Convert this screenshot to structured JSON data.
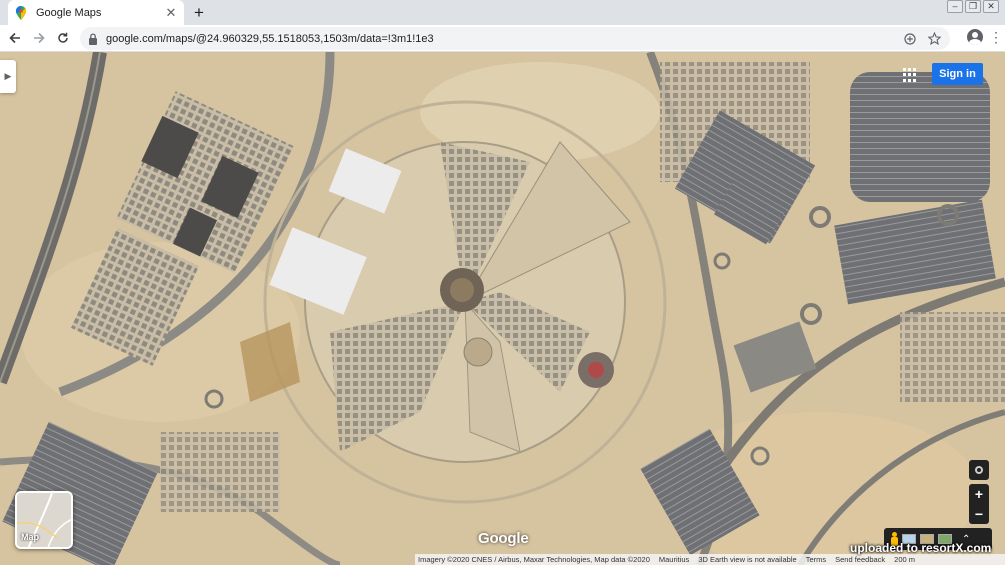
{
  "browser": {
    "tab_title": "Google Maps",
    "new_tab_symbol": "+",
    "url": "google.com/maps/@24.960329,55.1518053,1503m/data=!3m1!1e3",
    "icons": [
      "maps-favicon",
      "close-icon",
      "back-icon",
      "forward-icon",
      "reload-icon",
      "lock-icon",
      "add-icon",
      "star-icon",
      "profile-icon",
      "kebab-icon"
    ]
  },
  "map": {
    "sign_in_label": "Sign in",
    "minimap_label": "Map",
    "logo_text": "Google",
    "footer": {
      "imagery": "Imagery ©2020 CNES / Airbus, Maxar Technologies, Map data ©2020",
      "region": "Mauritius",
      "earth_note": "3D Earth view is not available",
      "terms": "Terms",
      "feedback": "Send feedback",
      "scale": "200 m"
    },
    "watermark": "uploaded to resortX.com",
    "colors": {
      "signin_bg": "#1a73e8",
      "sand": "#d8c6a2",
      "control_bg": "#222222"
    }
  }
}
